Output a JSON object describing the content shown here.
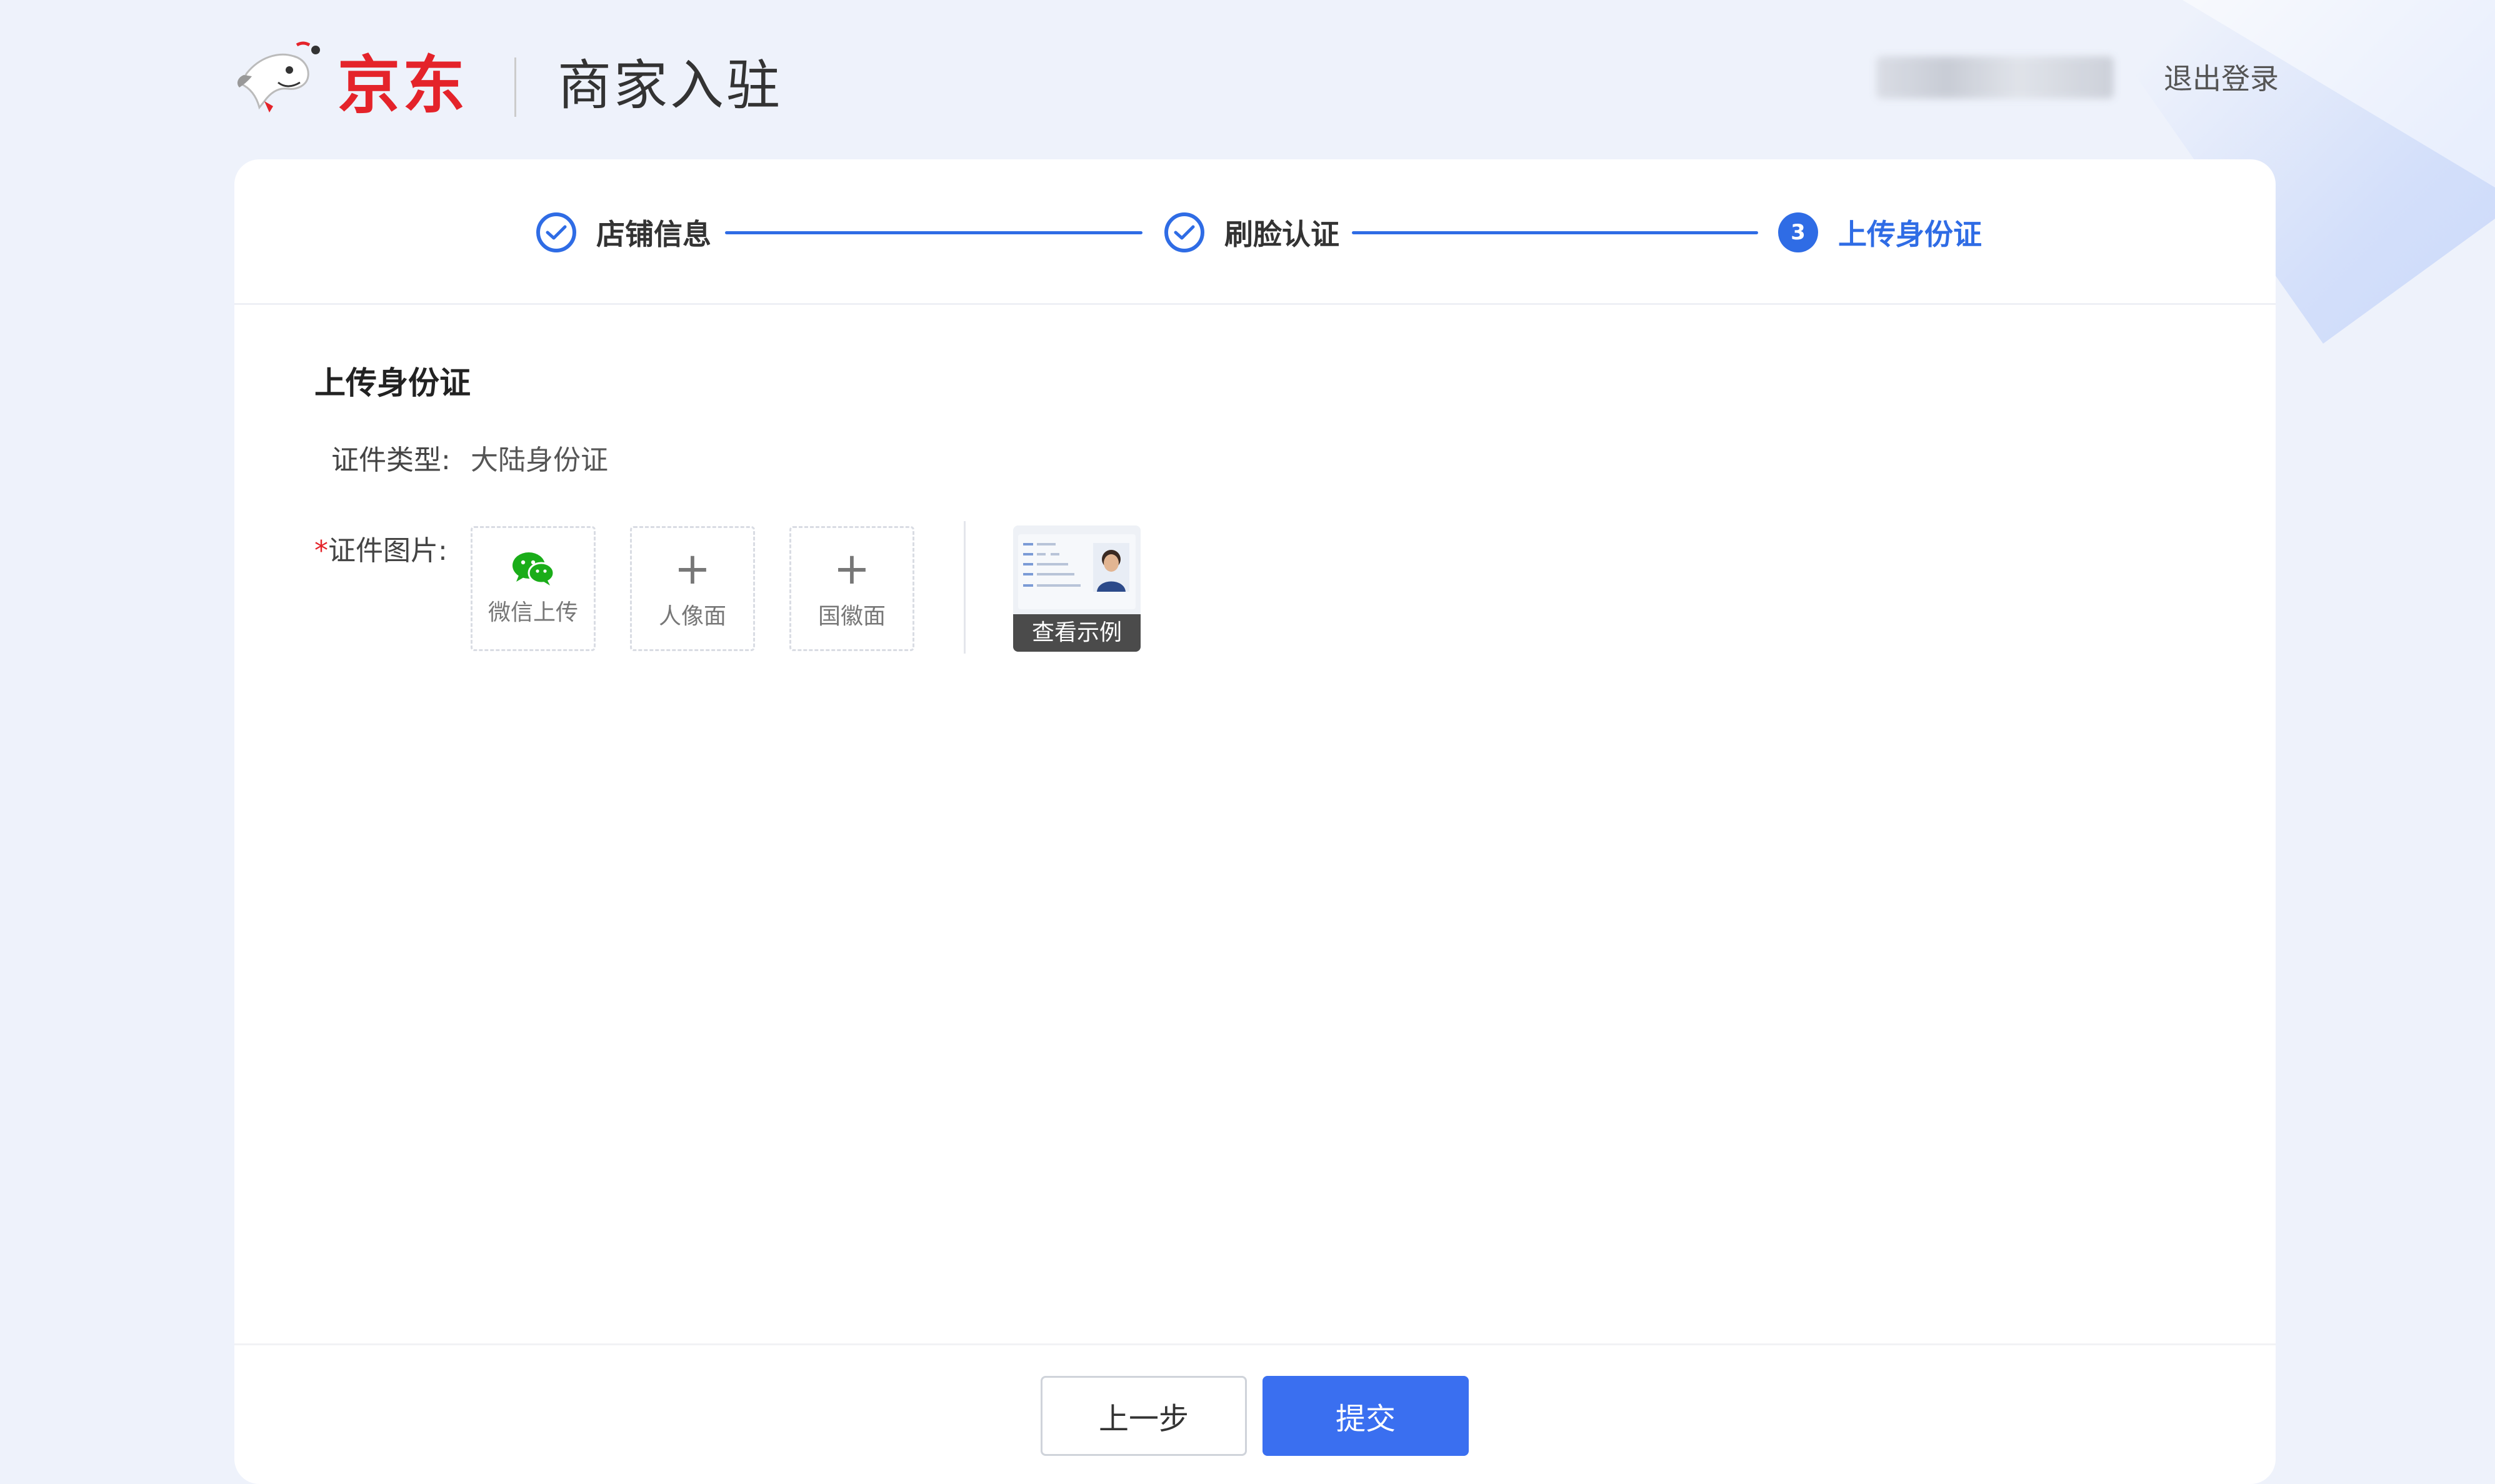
{
  "header": {
    "logo_text": "京东",
    "title": "商家入驻",
    "logout": "退出登录"
  },
  "steps": [
    {
      "label": "店铺信息",
      "status": "done"
    },
    {
      "label": "刷脸认证",
      "status": "done"
    },
    {
      "label": "上传身份证",
      "status": "current",
      "number": "3"
    }
  ],
  "form": {
    "section_title": "上传身份证",
    "doc_type_label": "证件类型:",
    "doc_type_value": "大陆身份证",
    "required_mark": "*",
    "doc_image_label": "证件图片:",
    "wechat_upload": "微信上传",
    "portrait_side": "人像面",
    "emblem_side": "国徽面",
    "plus": "+",
    "view_sample": "查看示例"
  },
  "buttons": {
    "prev": "上一步",
    "submit": "提交"
  },
  "colors": {
    "primary": "#2f6ce5",
    "brand_red": "#e4232a",
    "wechat_green": "#1aad19"
  }
}
